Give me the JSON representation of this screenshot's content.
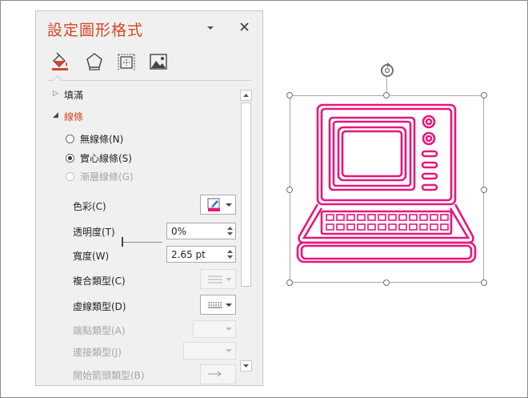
{
  "pane": {
    "title": "設定圖形格式",
    "tabs": [
      "fill-line-icon",
      "effects-icon",
      "size-properties-icon",
      "picture-icon"
    ]
  },
  "sections": {
    "fill": "填滿",
    "line": "線條"
  },
  "line_options": {
    "no_line": "無線條(N)",
    "solid_line": "實心線條(S)",
    "gradient_line": "漸層線條(G)",
    "selected": "實心線條(S)"
  },
  "props": {
    "color_label": "色彩(C)",
    "transparency_label": "透明度(T)",
    "transparency_value": "0%",
    "width_label": "寬度(W)",
    "width_value": "2.65 pt",
    "compound_label": "複合類型(C)",
    "dash_label": "虛線類型(D)",
    "cap_label": "端點類型(A)",
    "join_label": "連接類型(J)",
    "arrow_label": "開始箭頭類型(B)"
  },
  "colors": {
    "accent": "#d24726",
    "line_color": "#e8177b"
  },
  "icons": {
    "close": "close-icon",
    "dropdown": "pane-options-icon",
    "rotate": "rotate-handle-icon",
    "shape": "laptop-outline-icon"
  }
}
